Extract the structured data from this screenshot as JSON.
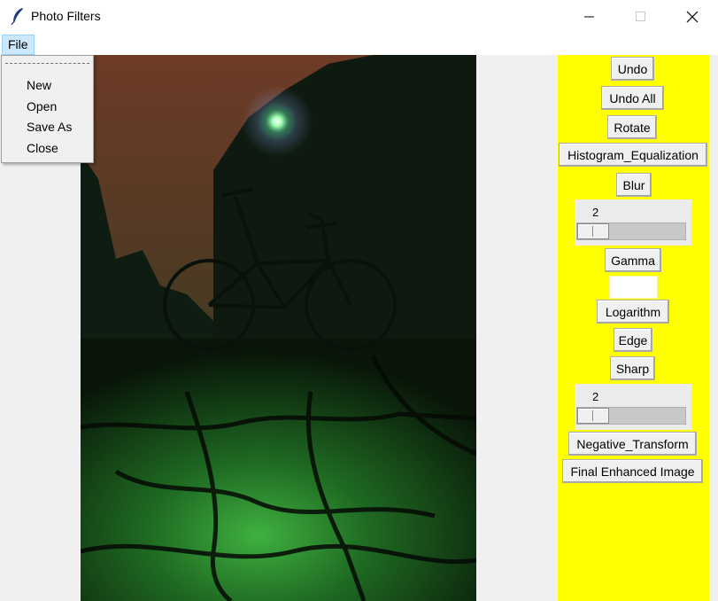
{
  "window": {
    "title": "Photo Filters",
    "icons": {
      "app": "feather-icon",
      "minimize": "minimize-icon",
      "maximize": "maximize-icon",
      "close": "close-icon"
    }
  },
  "menubar": {
    "file_label": "File"
  },
  "file_menu": {
    "items": [
      "New",
      "Open",
      "Save As",
      "Close"
    ]
  },
  "canvas": {
    "image": "night bicycle photo with green street light"
  },
  "panel": {
    "background": "#ffff00",
    "buttons": {
      "undo": "Undo",
      "undo_all": "Undo All",
      "rotate": "Rotate",
      "histogram": "Histogram_Equalization",
      "blur": "Blur",
      "gamma": "Gamma",
      "logarithm": "Logarithm",
      "edge": "Edge",
      "sharp": "Sharp",
      "negative": "Negative_Transform",
      "final": "Final Enhanced Image"
    },
    "blur_scale": {
      "value": "2"
    },
    "gamma_entry": {
      "value": ""
    },
    "sharp_scale": {
      "value": "2"
    }
  }
}
